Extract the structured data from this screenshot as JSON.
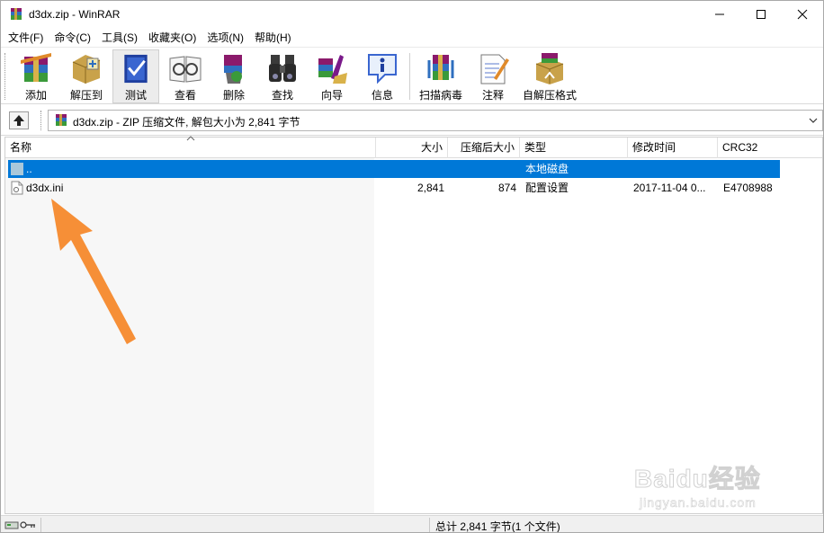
{
  "window": {
    "title": "d3dx.zip - WinRAR"
  },
  "menu": [
    {
      "label": "文件(F)"
    },
    {
      "label": "命令(C)"
    },
    {
      "label": "工具(S)"
    },
    {
      "label": "收藏夹(O)"
    },
    {
      "label": "选项(N)"
    },
    {
      "label": "帮助(H)"
    }
  ],
  "toolbar": [
    {
      "label": "添加",
      "icon": "add-archive-icon"
    },
    {
      "label": "解压到",
      "icon": "extract-to-icon"
    },
    {
      "label": "测试",
      "icon": "test-archive-icon"
    },
    {
      "label": "查看",
      "icon": "view-icon"
    },
    {
      "label": "删除",
      "icon": "delete-icon"
    },
    {
      "label": "查找",
      "icon": "find-icon"
    },
    {
      "label": "向导",
      "icon": "wizard-icon"
    },
    {
      "label": "信息",
      "icon": "info-icon"
    },
    {
      "label": "扫描病毒",
      "icon": "virus-scan-icon"
    },
    {
      "label": "注释",
      "icon": "comment-icon"
    },
    {
      "label": "自解压格式",
      "icon": "sfx-icon"
    }
  ],
  "address": {
    "text": "d3dx.zip - ZIP 压缩文件, 解包大小为 2,841 字节"
  },
  "columns": [
    {
      "label": "名称"
    },
    {
      "label": "大小"
    },
    {
      "label": "压缩后大小"
    },
    {
      "label": "类型"
    },
    {
      "label": "修改时间"
    },
    {
      "label": "CRC32"
    }
  ],
  "rows": [
    {
      "name": "..",
      "size": "",
      "packed": "",
      "type": "本地磁盘",
      "modified": "",
      "crc": "",
      "selected": true,
      "icon": "parent-folder-icon"
    },
    {
      "name": "d3dx.ini",
      "size": "2,841",
      "packed": "874",
      "type": "配置设置",
      "modified": "2017-11-04 0...",
      "crc": "E4708988",
      "selected": false,
      "icon": "ini-file-icon"
    }
  ],
  "status": {
    "text": "总计 2,841 字节(1 个文件)"
  },
  "watermark": {
    "brand": "Baidu经验",
    "url": "jingyan.baidu.com"
  },
  "colors": {
    "selection": "#0078d7",
    "annotation_arrow": "#f5892c"
  }
}
